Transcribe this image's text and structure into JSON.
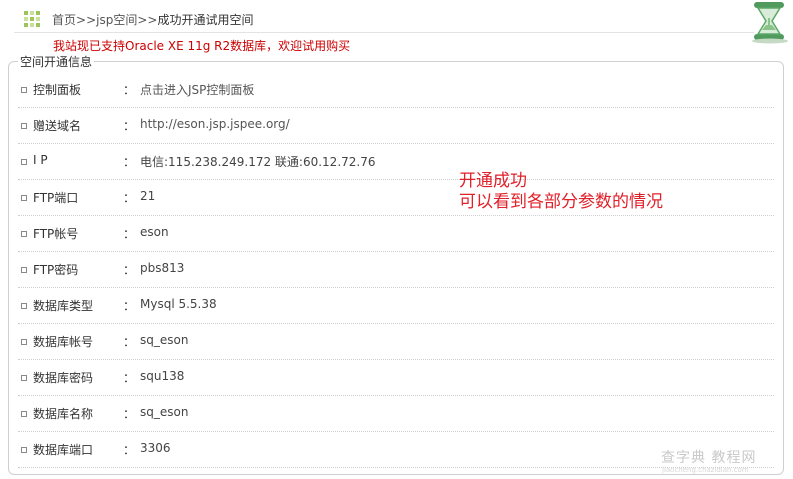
{
  "breadcrumb": {
    "home": "首页",
    "sep1": ">>",
    "section": "jsp空间",
    "sep2": ">>",
    "current": "成功开通试用空间"
  },
  "notice": "我站现已支持Oracle XE 11g R2数据库，欢迎试用购买",
  "panel_title": "空间开通信息",
  "rows": [
    {
      "label": "控制面板",
      "colon": "：",
      "value": "点击进入JSP控制面板"
    },
    {
      "label": "赠送域名",
      "colon": "：",
      "value": "http://eson.jsp.jspee.org/"
    },
    {
      "label": "I P",
      "colon": "：",
      "value": "电信:115.238.249.172 联通:60.12.72.76"
    },
    {
      "label": "FTP端口",
      "colon": "：",
      "value": "21"
    },
    {
      "label": "FTP帐号",
      "colon": "：",
      "value": "eson"
    },
    {
      "label": "FTP密码",
      "colon": "：",
      "value": "pbs813"
    },
    {
      "label": "数据库类型",
      "colon": "：",
      "value": "Mysql 5.5.38"
    },
    {
      "label": "数据库帐号",
      "colon": "：",
      "value": "sq_eson"
    },
    {
      "label": "数据库密码",
      "colon": "：",
      "value": "squ138"
    },
    {
      "label": "数据库名称",
      "colon": "：",
      "value": "sq_eson"
    },
    {
      "label": "数据库端口",
      "colon": "：",
      "value": "3306"
    }
  ],
  "annotation": {
    "line1": "开通成功",
    "line2": "可以看到各部分参数的情况"
  },
  "watermark": {
    "main": "查字典 教程网",
    "sub": "jiaocheng.chazidian.com"
  },
  "colors": {
    "notice": "#cc0000",
    "annotation": "#e0202a",
    "icon_green": "#9cc45a"
  },
  "icons": {
    "breadcrumb": "grid-icon",
    "corner": "hourglass-icon",
    "row_bullet": "square-bullet-icon"
  }
}
